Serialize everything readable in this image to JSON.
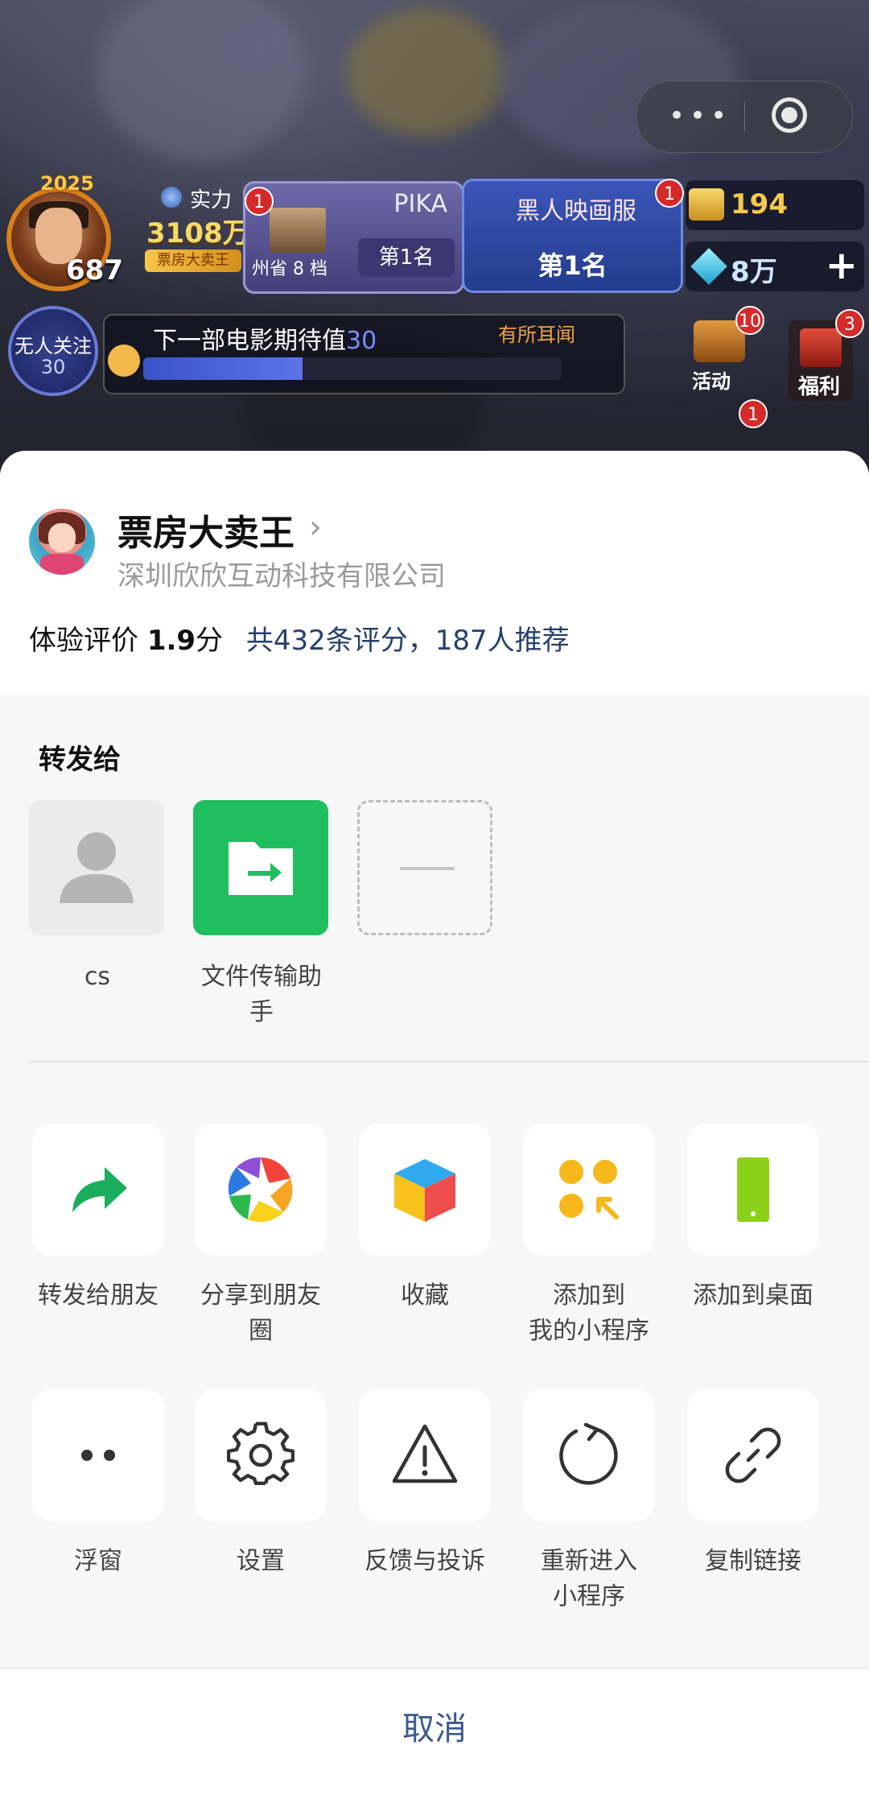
{
  "game": {
    "year_badge": "2025",
    "player_level": "687",
    "power_label": "实力",
    "power_value": "3108万",
    "title_tag": "票房大卖王",
    "card_pika": {
      "name": "PIKA",
      "location": "州省 8 档",
      "rank": "第1名",
      "notify": "1"
    },
    "card_black": {
      "name": "黑人映画服",
      "rank": "第1名",
      "notify": "1"
    },
    "coins": "194",
    "gems": "8万",
    "gems_add": "+",
    "follow_label": "无人关注",
    "follow_count": "30",
    "expect_label": "下一部电影期待值",
    "expect_value": "30",
    "expect_hint": "有所耳闻",
    "expect_progress": 0.38,
    "activity_label": "活动",
    "activity_count": "10",
    "welfare_label": "福利",
    "welfare_count": "3",
    "extra_count": "1"
  },
  "capsule": {
    "more_icon": "more-dots-icon",
    "close_icon": "target-icon"
  },
  "sheet": {
    "app_name": "票房大卖王",
    "company": "深圳欣欣互动科技有限公司",
    "rating_prefix": "体验评价",
    "rating_score": "1.9",
    "rating_unit": "分",
    "rating_summary": "共432条评分，187人推荐",
    "share_title": "转发给",
    "contacts": [
      {
        "label": "cs",
        "icon": "person-icon"
      },
      {
        "label": "文件传输助手",
        "icon": "file-transfer-icon"
      },
      {
        "label": "",
        "icon": "more-contacts-icon"
      }
    ],
    "actions_row1": [
      {
        "label": "转发给朋友",
        "icon": "forward-arrow-icon"
      },
      {
        "label": "分享到朋友圈",
        "icon": "moments-aperture-icon"
      },
      {
        "label": "收藏",
        "icon": "favorites-cube-icon"
      },
      {
        "label": "添加到\n我的小程序",
        "icon": "add-to-my-miniprogram-icon"
      },
      {
        "label": "添加到桌面",
        "icon": "add-to-desktop-icon"
      }
    ],
    "actions_row2": [
      {
        "label": "浮窗",
        "icon": "floating-window-icon"
      },
      {
        "label": "设置",
        "icon": "gear-icon"
      },
      {
        "label": "反馈与投诉",
        "icon": "warning-icon"
      },
      {
        "label": "重新进入\n小程序",
        "icon": "reload-icon"
      },
      {
        "label": "复制链接",
        "icon": "link-icon"
      }
    ],
    "cancel_label": "取消"
  },
  "colors": {
    "accent_green": "#1fbe5f",
    "link_blue": "#26406e",
    "cancel_blue": "#3c5a8c"
  }
}
